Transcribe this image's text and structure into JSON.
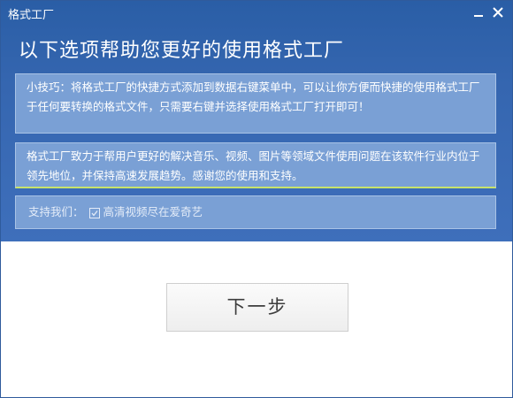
{
  "window": {
    "title": "格式工厂"
  },
  "heading": "以下选项帮助您更好的使用格式工厂",
  "tip_text": "小技巧：将格式工厂的快捷方式添加到数据右键菜单中，可以让你方便而快捷的使用格式工厂于任何要转换的格式文件，只需要右键并选择使用格式工厂打开即可！",
  "about_text": "格式工厂致力于帮用户更好的解决音乐、视频、图片等领域文件使用问题在该软件行业内位于领先地位，并保持高速发展趋势。感谢您的使用和支持。",
  "support": {
    "label": "支持我们：",
    "checked": true,
    "link": "高清视频尽在爱奇艺"
  },
  "next_button": "下一步",
  "icons": {
    "minimize": "minimize-icon",
    "close": "close-icon",
    "checkbox": "checkbox-icon"
  },
  "colors": {
    "header_blue": "#3566b0",
    "panel_blue": "#7aa0d5",
    "accent_green": "#c8e36b"
  }
}
